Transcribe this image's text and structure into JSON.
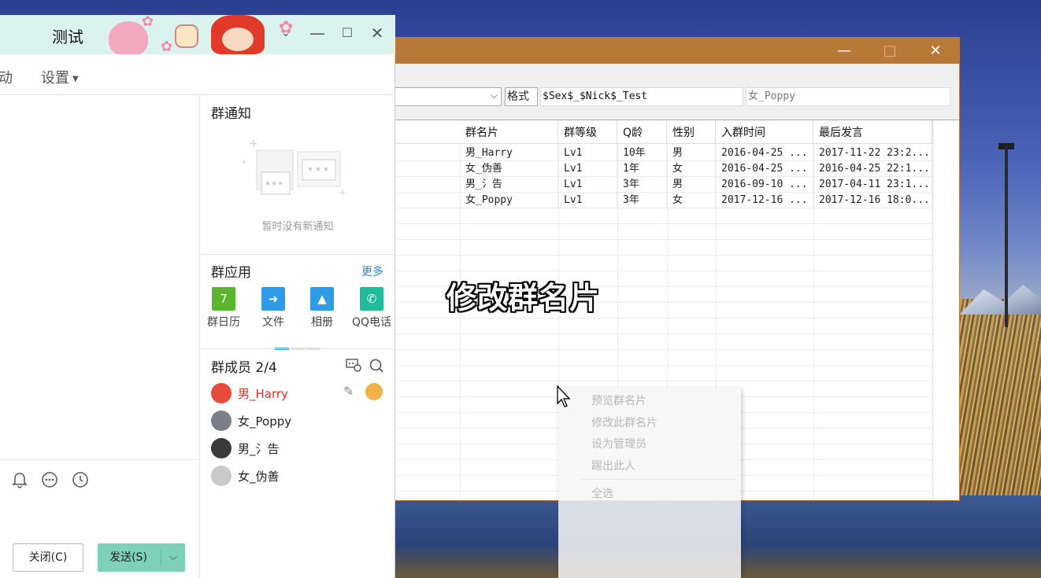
{
  "qq_window": {
    "title": "测试",
    "nav": [
      {
        "label": "动"
      },
      {
        "label": "设置"
      }
    ],
    "notice": {
      "title": "群通知",
      "empty_text": "暂时没有新通知"
    },
    "apps": {
      "title": "群应用",
      "more": "更多",
      "items": [
        {
          "label": "群日历",
          "icon": "calendar-icon",
          "color": "#5cb531"
        },
        {
          "label": "文件",
          "icon": "file-icon",
          "color": "#2f9be6"
        },
        {
          "label": "相册",
          "icon": "album-icon",
          "color": "#2f9be6"
        },
        {
          "label": "QQ电话",
          "icon": "phone-icon",
          "color": "#1fbb9b"
        }
      ]
    },
    "members": {
      "title": "群成员 2/4",
      "items": [
        {
          "name": "男_Harry"
        },
        {
          "name": "女_Poppy"
        },
        {
          "name": "男_氵告"
        },
        {
          "name": "女_伪善"
        }
      ]
    },
    "buttons": {
      "close": "关闭(C)",
      "send": "发送(S)"
    },
    "calendar_day": "7"
  },
  "app_window": {
    "format_label": "格式",
    "format_value": "$Sex$_$Nick$_Test",
    "preview_value": "女_Poppy",
    "columns": [
      "群名片",
      "群等级",
      "Q龄",
      "性别",
      "入群时间",
      "最后发言"
    ],
    "rows": [
      [
        "男_Harry",
        "Lv1",
        "10年",
        "男",
        "2016-04-25 ...",
        "2017-11-22 23:2..."
      ],
      [
        "女_伪善",
        "Lv1",
        "1年",
        "女",
        "2016-04-25 ...",
        "2016-04-25 22:1..."
      ],
      [
        "男_氵告",
        "Lv1",
        "3年",
        "男",
        "2016-09-10 ...",
        "2017-04-11 23:1..."
      ],
      [
        "女_Poppy",
        "Lv1",
        "3年",
        "女",
        "2017-12-16 ...",
        "2017-12-16 18:0..."
      ]
    ]
  },
  "overlay_caption": "修改群名片",
  "context_menu": {
    "items": [
      "预览群名片",
      "修改此群名片",
      "设为管理员",
      "踢出此人",
      "全选"
    ]
  },
  "colors": {
    "qq_header_bg": "#daf3ef",
    "send_button": "#7ed0b6",
    "app_titlebar": "#b87838",
    "owner_name": "#d0362c",
    "link": "#1e8ad6"
  }
}
